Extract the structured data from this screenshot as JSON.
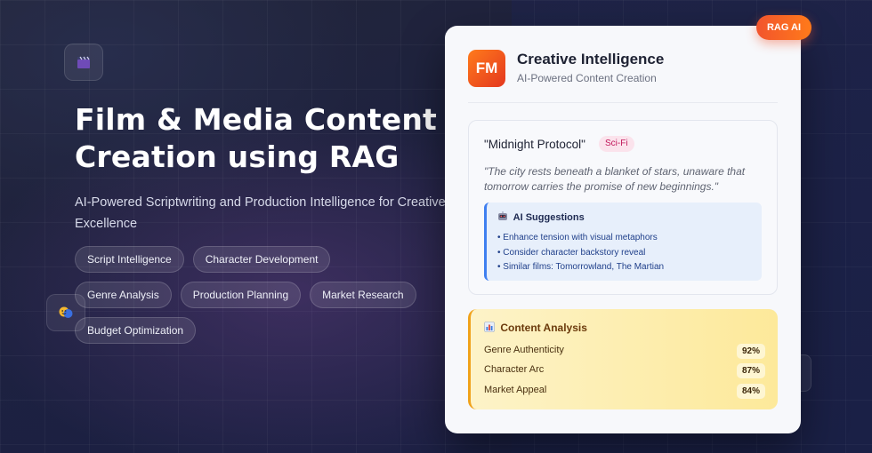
{
  "hero": {
    "title_line1": "Film & Media Content",
    "title_line2": "Creation using RAG",
    "subtitle": "AI-Powered Scriptwriting and Production Intelligence for Creative Excellence"
  },
  "tags": [
    [
      "Script Intelligence",
      "Character Development"
    ],
    [
      "Genre Analysis",
      "Production Planning",
      "Market Research"
    ],
    [
      "Budget Optimization"
    ]
  ],
  "icons": {
    "floating_top": "clapperboard-icon",
    "floating_mid": "theater-masks-icon",
    "suggestions": "robot-icon",
    "analysis": "bar-chart-icon"
  },
  "badge": {
    "label": "RAG AI"
  },
  "card": {
    "logo": "FM",
    "title": "Creative Intelligence",
    "subtitle": "AI-Powered Content Creation"
  },
  "script": {
    "title": "\"Midnight Protocol\"",
    "genre": "Sci-Fi",
    "quote": "\"The city rests beneath a blanket of stars, unaware that tomorrow carries the promise of new beginnings.\""
  },
  "suggestions": {
    "title": "AI Suggestions",
    "items": [
      "• Enhance tension with visual metaphors",
      "• Consider character backstory reveal",
      "• Similar films: Tomorrowland, The Martian"
    ]
  },
  "analysis": {
    "title": "Content Analysis",
    "metrics": [
      {
        "label": "Genre Authenticity",
        "value": "92%"
      },
      {
        "label": "Character Arc",
        "value": "87%"
      },
      {
        "label": "Market Appeal",
        "value": "84%"
      }
    ]
  },
  "colors": {
    "background": "#1b1f3a",
    "accent_orange": "#f2542d",
    "suggestion_blue": "#3f7ff0",
    "analysis_amber": "#f0a21a"
  }
}
